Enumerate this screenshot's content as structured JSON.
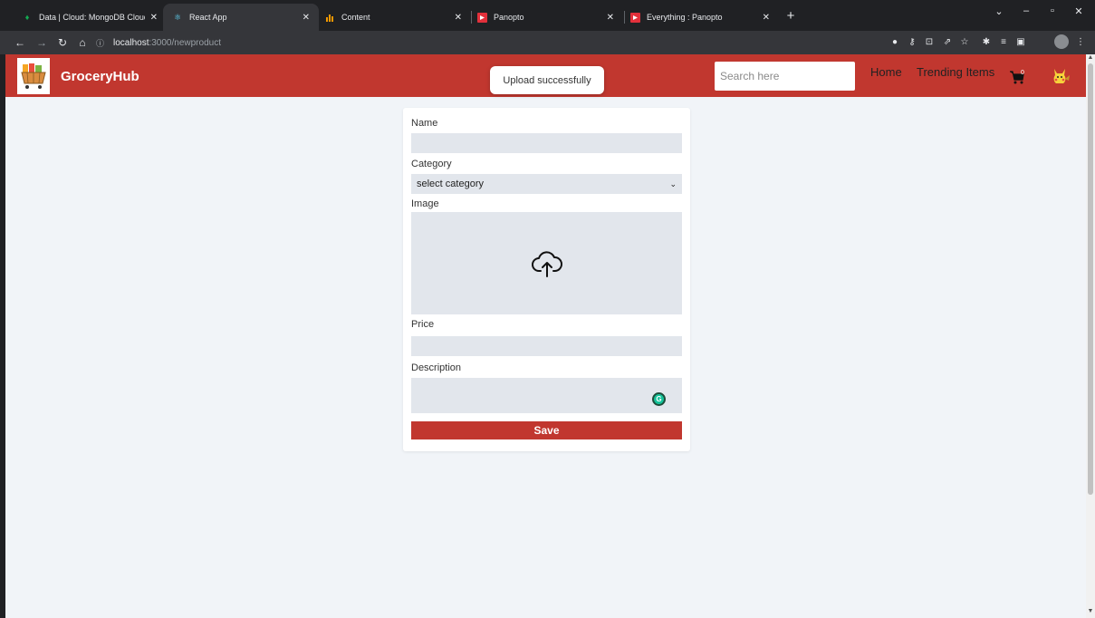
{
  "browser": {
    "tabs": [
      {
        "title": "Data | Cloud: MongoDB Cloud",
        "icon": "mongodb-leaf-icon",
        "active": false
      },
      {
        "title": "React App",
        "icon": "react-icon",
        "active": true
      },
      {
        "title": "Content",
        "icon": "bar-chart-icon",
        "active": false
      },
      {
        "title": "Panopto",
        "icon": "panopto-icon",
        "active": false
      },
      {
        "title": "Everything : Panopto",
        "icon": "panopto-icon",
        "active": false
      }
    ],
    "url_host": "localhost",
    "url_path": ":3000/newproduct"
  },
  "header": {
    "brand": "GroceryHub",
    "toast": "Upload successfully",
    "search_placeholder": "Search here",
    "nav": {
      "home": "Home",
      "trending": "Trending Items"
    },
    "cart_count": "0"
  },
  "form": {
    "name_label": "Name",
    "category_label": "Category",
    "category_selected": "select category",
    "image_label": "Image",
    "price_label": "Price",
    "description_label": "Description",
    "save_label": "Save"
  },
  "colors": {
    "header_bg": "#c1372f",
    "page_bg": "#f1f4f8",
    "input_bg": "#e2e6ec",
    "save_bg": "#c1372f"
  }
}
